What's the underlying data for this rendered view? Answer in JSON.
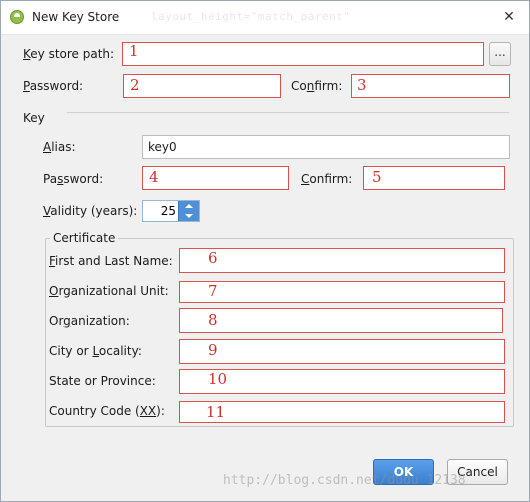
{
  "window": {
    "title": "New Key Store",
    "background_hint_text": "layout_height=\"match_parent\"",
    "close_glyph": "✕"
  },
  "key_store": {
    "path_label_u": "K",
    "path_label_rest": "ey store path:",
    "path_value": "",
    "path_mark": "1",
    "browse_label": "...",
    "password_label_u": "P",
    "password_label_rest": "assword:",
    "password_mark": "2",
    "confirm_label_pre": "Co",
    "confirm_label_u": "n",
    "confirm_label_rest": "firm:",
    "confirm_mark": "3"
  },
  "key": {
    "section_label": "Key",
    "alias_label_u": "A",
    "alias_label_rest": "lias:",
    "alias_value": "key0",
    "password_label_pre": "Pa",
    "password_label_u": "s",
    "password_label_rest": "sword:",
    "password_mark": "4",
    "confirm_label_u": "C",
    "confirm_label_rest": "onfirm:",
    "confirm_mark": "5",
    "validity_label_u": "V",
    "validity_label_rest": "alidity (years):",
    "validity_value": "25"
  },
  "certificate": {
    "legend": "Certificate",
    "fields": [
      {
        "label_u": "F",
        "label_rest": "irst and Last Name:",
        "mark": "6"
      },
      {
        "label_u": "O",
        "label_rest": "rganizational Unit:",
        "mark": "7"
      },
      {
        "label_pre": "Or",
        "label_u": "g",
        "label_rest": "anization:",
        "mark": "8"
      },
      {
        "label_pre": "City or ",
        "label_u": "L",
        "label_rest": "ocality:",
        "mark": "9"
      },
      {
        "label_pre": "State or Province:",
        "label_u": "",
        "label_rest": "",
        "mark": "10"
      },
      {
        "label_pre": "Country Code (",
        "label_u": "XX",
        "label_rest": "):",
        "mark": "11"
      }
    ]
  },
  "buttons": {
    "ok": "OK",
    "cancel": "Cancel"
  },
  "watermark": "http://blog.csdn.net/dudu 12138",
  "colors": {
    "annotation_red": "#d0302a",
    "ok_blue": "#3a7fd0",
    "spinner_blue": "#4f8fd6"
  }
}
